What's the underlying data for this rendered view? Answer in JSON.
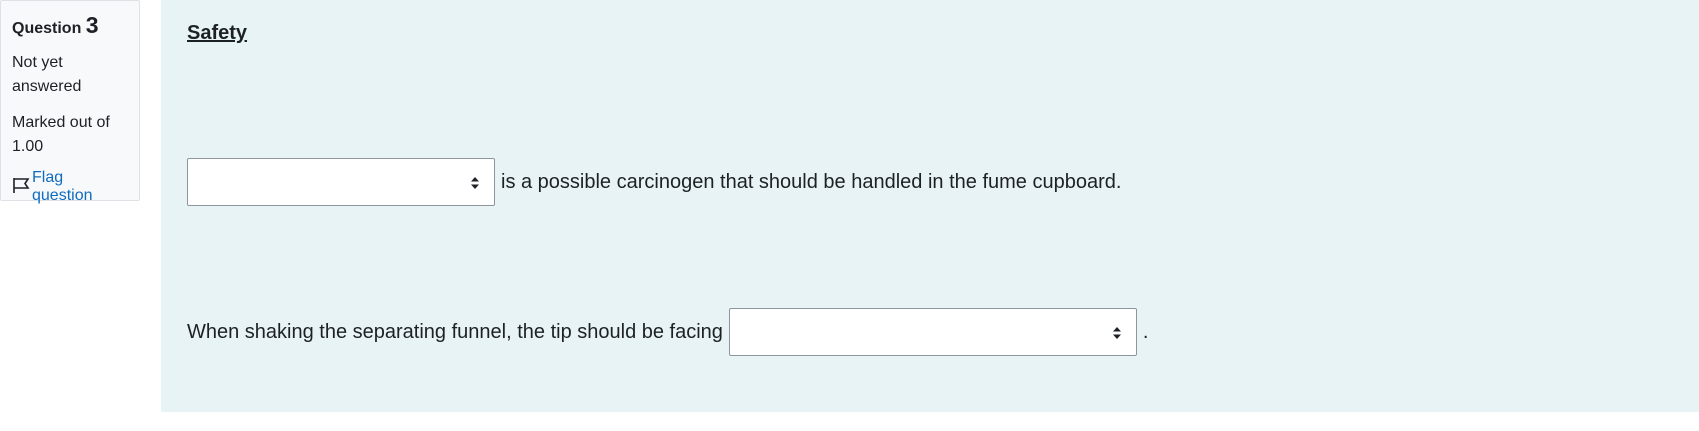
{
  "info": {
    "question_word": "Question",
    "question_number": "3",
    "state": "Not yet answered",
    "grade": "Marked out of 1.00",
    "flag_label": "Flag question"
  },
  "question": {
    "title": "Safety",
    "line1": {
      "select_value": "",
      "text_after": "is a possible carcinogen that should be handled in the fume cupboard."
    },
    "line2": {
      "text_before": "When shaking the separating funnel, the tip should be facing",
      "select_value": "",
      "text_after": "."
    }
  },
  "colors": {
    "content_bg": "#e7f3f5",
    "info_bg": "#f8f9fa",
    "link": "#0f6cbf"
  },
  "icons": {
    "flag": "flag-icon",
    "select_arrows": "sort-arrows-icon"
  }
}
